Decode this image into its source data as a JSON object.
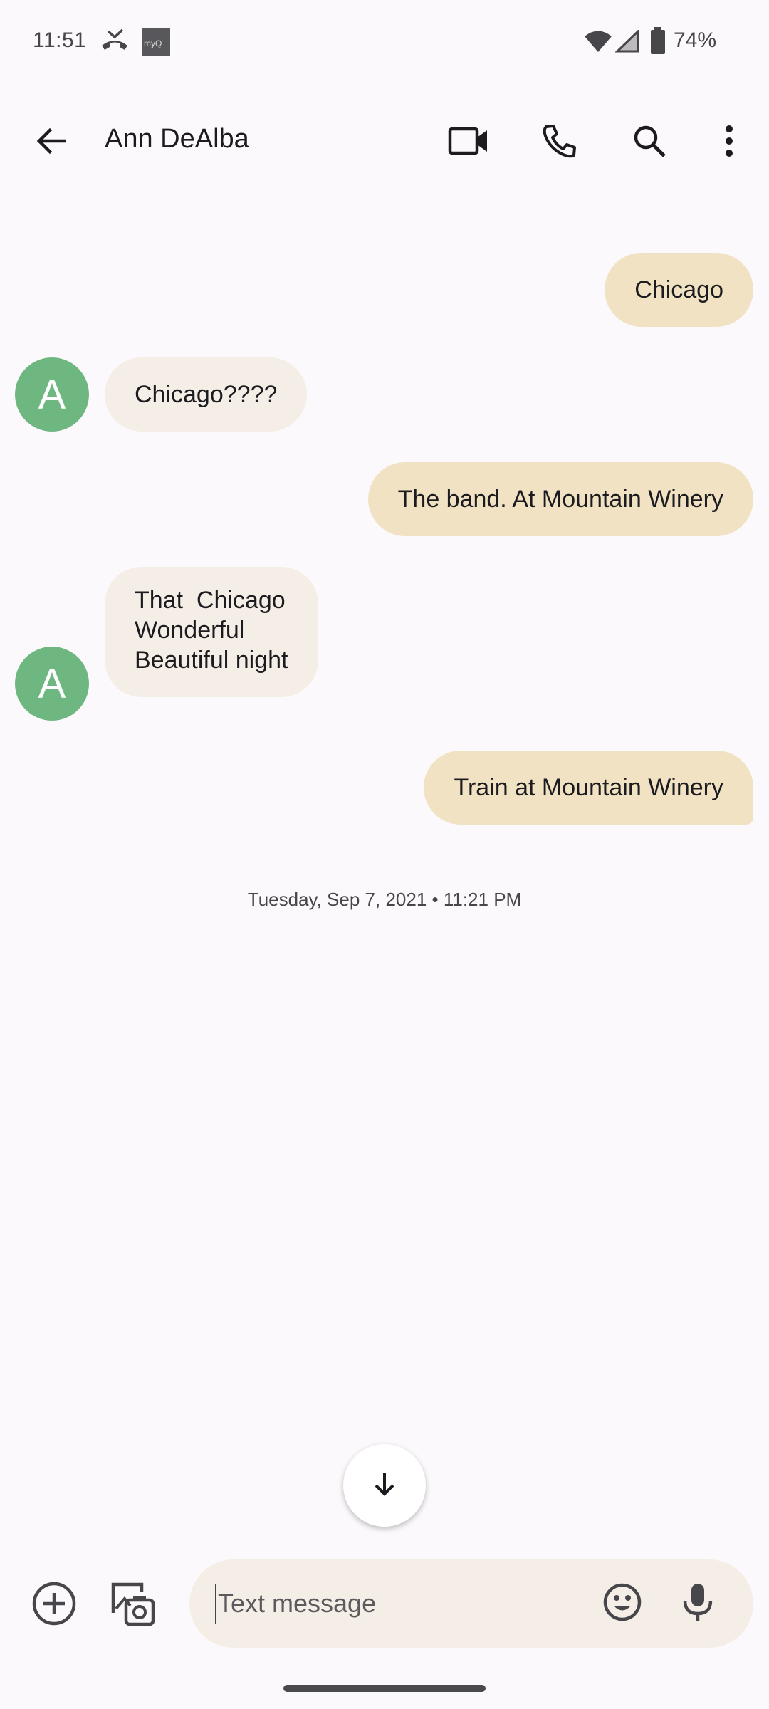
{
  "status_bar": {
    "time": "11:51",
    "battery": "74%",
    "icons": [
      "missed-call-icon",
      "myq-app-icon",
      "wifi-icon",
      "cell-signal-icon",
      "battery-icon"
    ],
    "myq_label": "myQ"
  },
  "app_bar": {
    "contact_name": "Ann DeAlba",
    "icons": [
      "back-arrow-icon",
      "video-call-icon",
      "phone-icon",
      "search-icon",
      "more-vert-icon"
    ]
  },
  "messages": [
    {
      "direction": "outgoing",
      "text": "Chicago"
    },
    {
      "direction": "incoming",
      "avatar": "A",
      "text": "Chicago????"
    },
    {
      "direction": "outgoing",
      "text": "The band. At Mountain Winery"
    },
    {
      "direction": "incoming",
      "avatar": "A",
      "lines": [
        "That  Chicago",
        "Wonderful",
        "Beautiful night"
      ]
    },
    {
      "direction": "outgoing",
      "text": "Train at Mountain Winery"
    }
  ],
  "timestamp": "Tuesday, Sep 7, 2021 • 11:21 PM",
  "compose": {
    "placeholder": "Text message",
    "value": ""
  },
  "colors": {
    "background": "#fcf9fc",
    "outgoing_bubble": "#f0e2c2",
    "incoming_bubble": "#f5eee7",
    "avatar": "#6fb780"
  }
}
